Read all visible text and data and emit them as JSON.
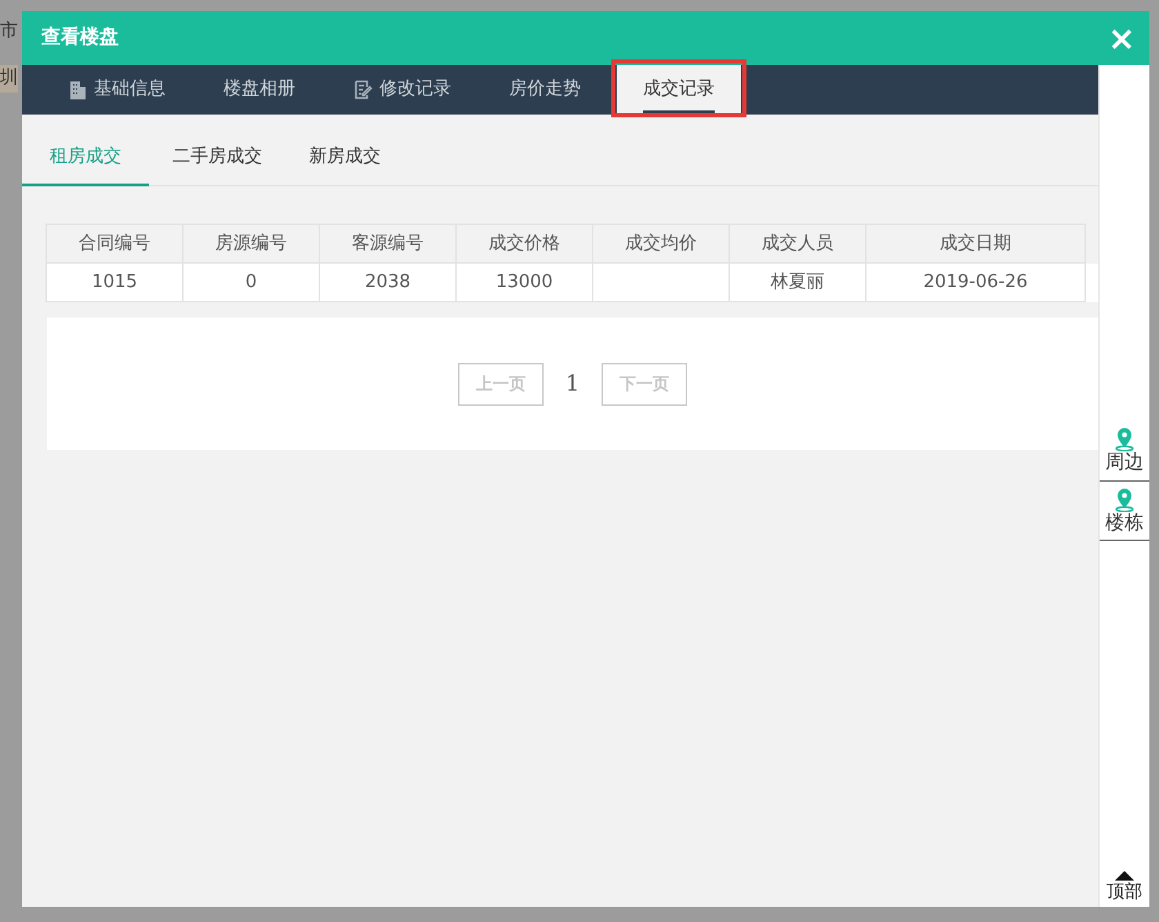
{
  "background": {
    "texts": [
      "市",
      "圳"
    ]
  },
  "window": {
    "title": "查看楼盘",
    "close": "×"
  },
  "tabs": [
    {
      "label": "基础信息",
      "selected": false,
      "highlight": false
    },
    {
      "label": "楼盘相册",
      "selected": false,
      "highlight": false
    },
    {
      "label": "修改记录",
      "selected": false,
      "highlight": false
    },
    {
      "label": "房价走势",
      "selected": false,
      "highlight": false
    },
    {
      "label": "成交记录",
      "selected": true,
      "highlight": true
    }
  ],
  "subtabs": [
    {
      "label": "租房成交",
      "selected": true
    },
    {
      "label": "二手房成交",
      "selected": false
    },
    {
      "label": "新房成交",
      "selected": false
    }
  ],
  "table": {
    "columns": [
      "合同编号",
      "房源编号",
      "客源编号",
      "成交价格",
      "成交均价",
      "成交人员",
      "成交日期"
    ],
    "rows": [
      [
        "1015",
        "0",
        "2038",
        "13000",
        "",
        "林夏丽",
        "2019-06-26"
      ]
    ]
  },
  "pagination": {
    "prev": {
      "label": "上一页",
      "disabled": true
    },
    "page": "1",
    "next": {
      "label": "下一页",
      "disabled": true
    }
  },
  "side_nav": [
    {
      "label": "周边"
    },
    {
      "label": "楼栋"
    }
  ],
  "back_to_top": "顶部"
}
